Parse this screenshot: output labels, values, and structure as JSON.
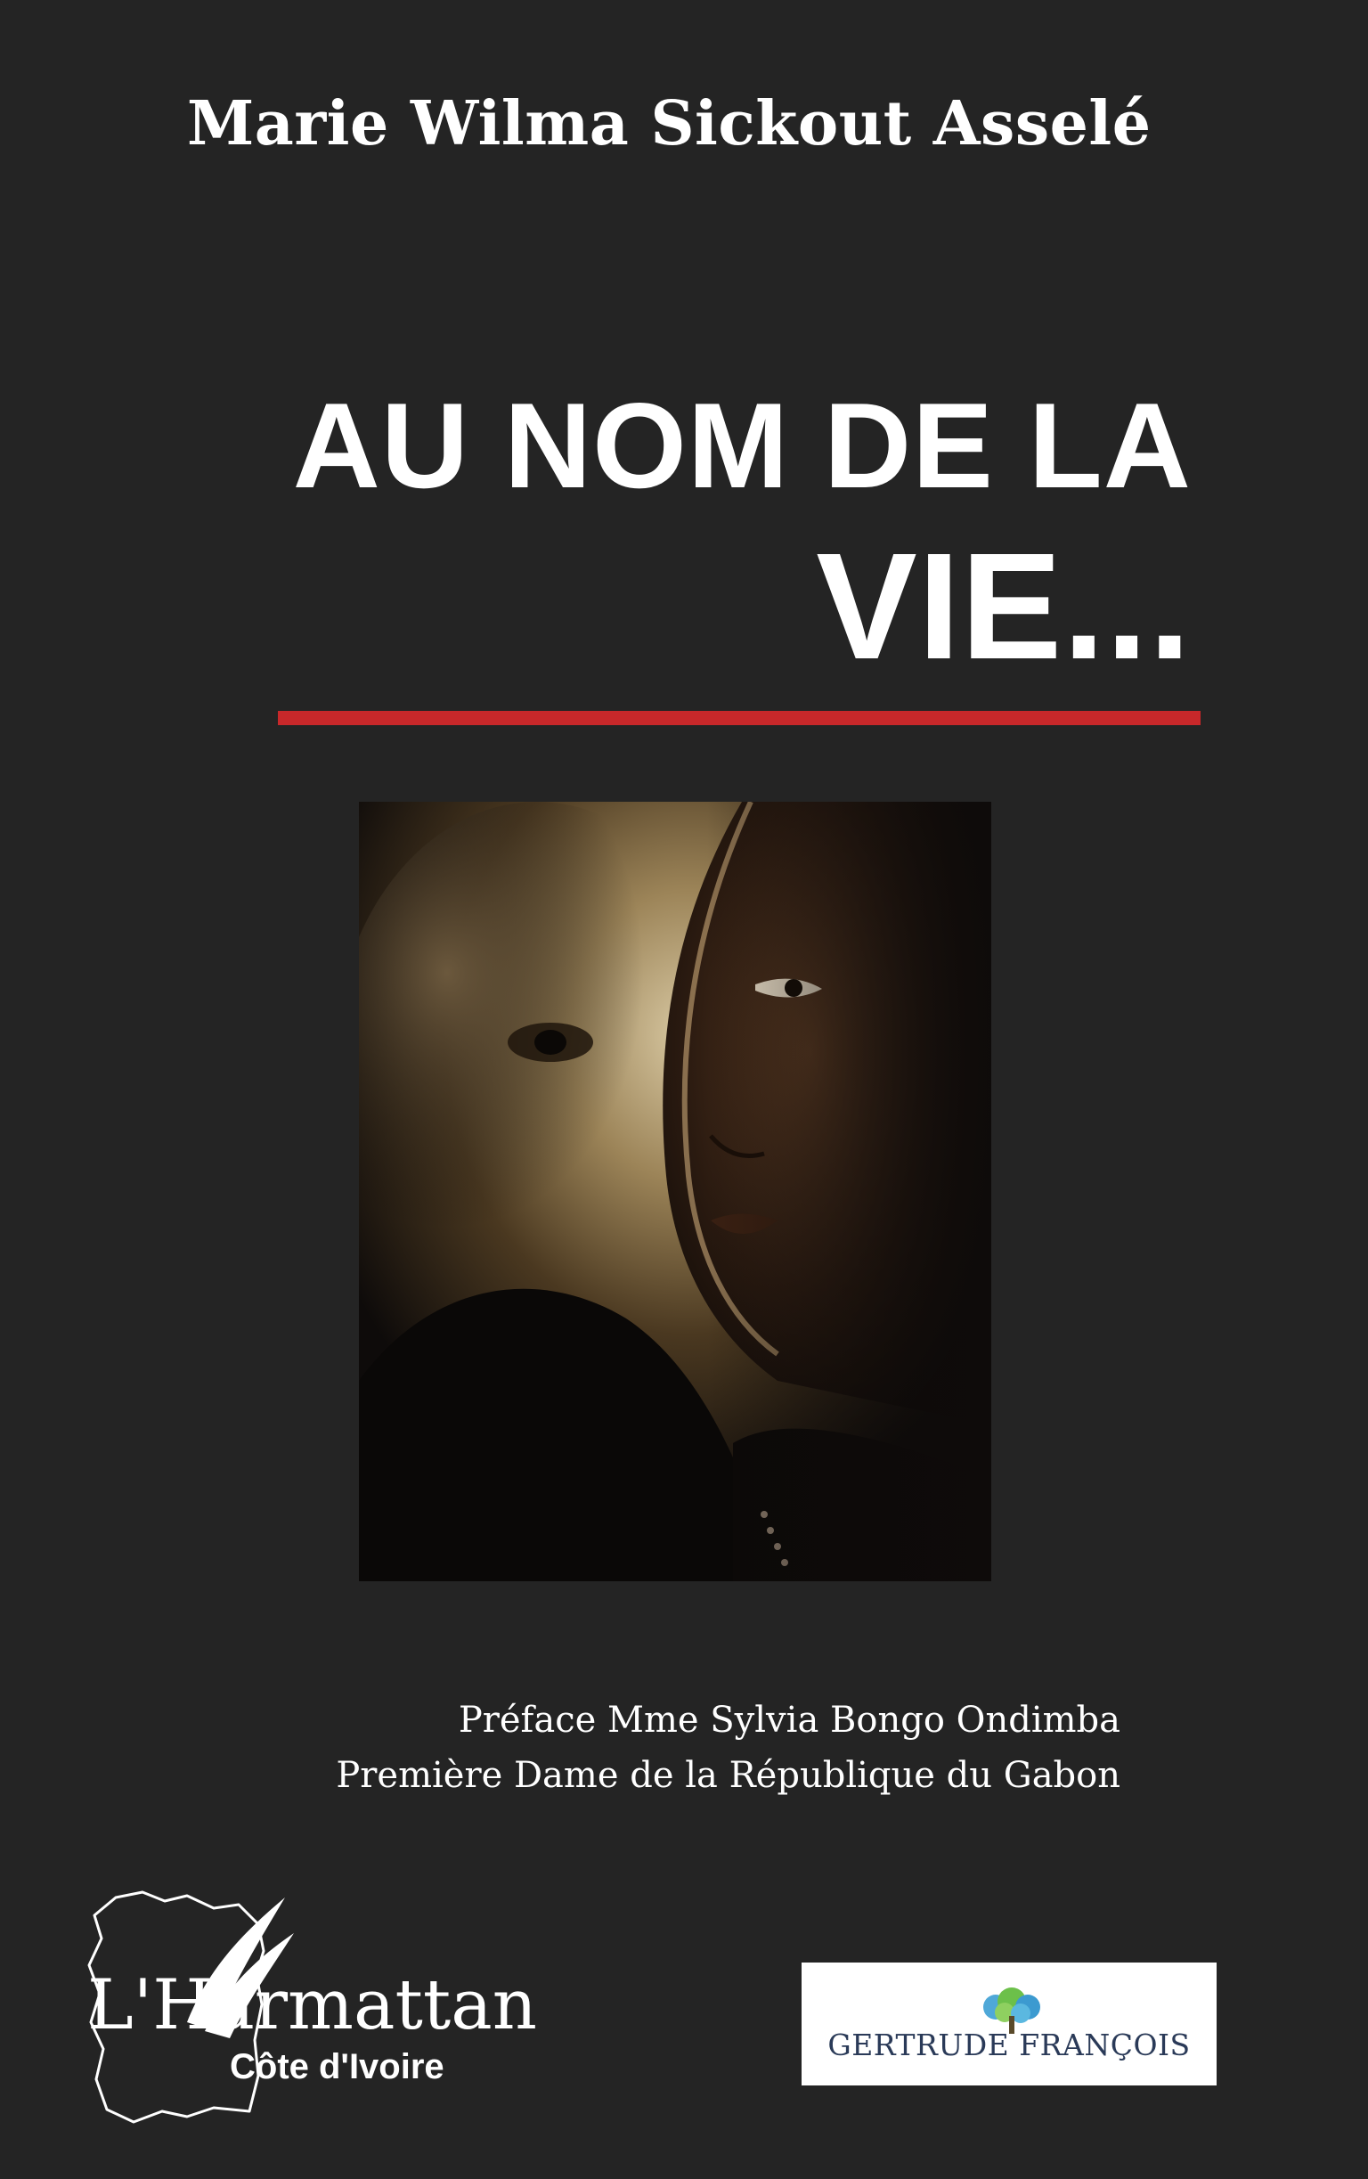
{
  "cover": {
    "author": "Marie Wilma Sickout Asselé",
    "title_line1": "AU NOM DE LA",
    "title_line2": "VIE...",
    "preface_line1": "Préface Mme Sylvia Bongo Ondimba",
    "preface_line2": "Première Dame de la République du Gabon",
    "publisher_name": "L'Harmattan",
    "publisher_sub": "Côte d'Ivoire",
    "imprint_name": "GERTRUDE FRANÇOIS"
  },
  "colors": {
    "background": "#242424",
    "text": "#ffffff",
    "accent_rule": "#c8282a",
    "imprint_text": "#2a3a58"
  },
  "icons": {
    "publisher_logo": "ivory-coast-map-feather-icon",
    "imprint_logo": "tree-icon"
  }
}
